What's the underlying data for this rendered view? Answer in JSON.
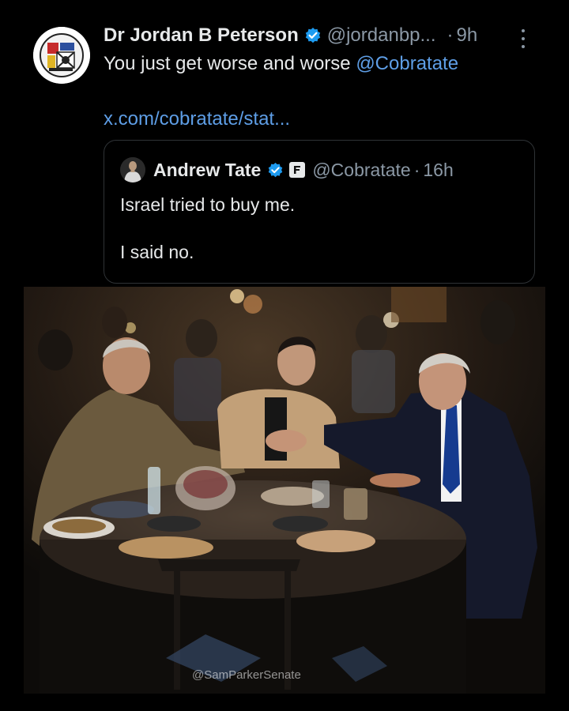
{
  "tweet": {
    "author_name": "Dr Jordan B Peterson",
    "handle": "@jordanbp...",
    "separator": "·",
    "time": "9h",
    "text_prefix": "You just get worse and worse ",
    "mention": "@Cobratate",
    "link": "x.com/cobratate/stat...",
    "icons": {
      "avatar": "profile-avatar",
      "verified": "verified-badge-icon",
      "more": "more-options-icon"
    }
  },
  "quote": {
    "author_name": "Andrew Tate",
    "handle": "@Cobratate",
    "separator": "·",
    "time": "16h",
    "line1": "Israel tried to buy me.",
    "line2": "I said no.",
    "icons": {
      "avatar": "profile-avatar",
      "verified": "verified-badge-icon",
      "affiliate": "affiliate-badge-icon"
    }
  },
  "media": {
    "watermark": "@SamParkerSenate"
  },
  "colors": {
    "background": "#000000",
    "text_primary": "#e7e9ea",
    "text_secondary": "#8b98a5",
    "link": "#5e9ee6",
    "verified": "#1d9bf0",
    "card_border": "#2f3336"
  }
}
